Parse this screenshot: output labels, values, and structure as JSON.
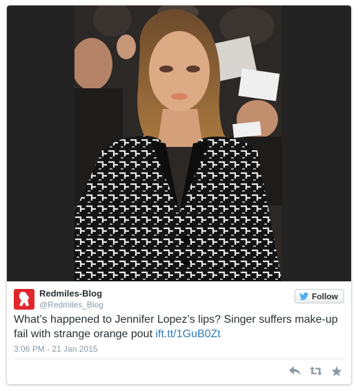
{
  "tweet": {
    "author_name": "Redmiles-Blog",
    "author_handle": "@Redmiles_Blog",
    "follow_label": "Follow",
    "text": "What’s happened to Jennifer Lopez’s lips? Singer suffers make-up fail with strange orange pout ",
    "link": "ift.tt/1GuB0Zt",
    "timestamp": "3:06 PM - 21 Jan 2015"
  },
  "icons": {
    "follow": "twitter-bird-icon",
    "reply": "reply-icon",
    "retweet": "retweet-icon",
    "favorite": "star-icon"
  },
  "colors": {
    "link": "#2b7bb9",
    "avatar_bg": "#e0262d",
    "twitter_blue": "#55acee",
    "action_gray": "#8899a6",
    "media_bg": "#232323"
  }
}
